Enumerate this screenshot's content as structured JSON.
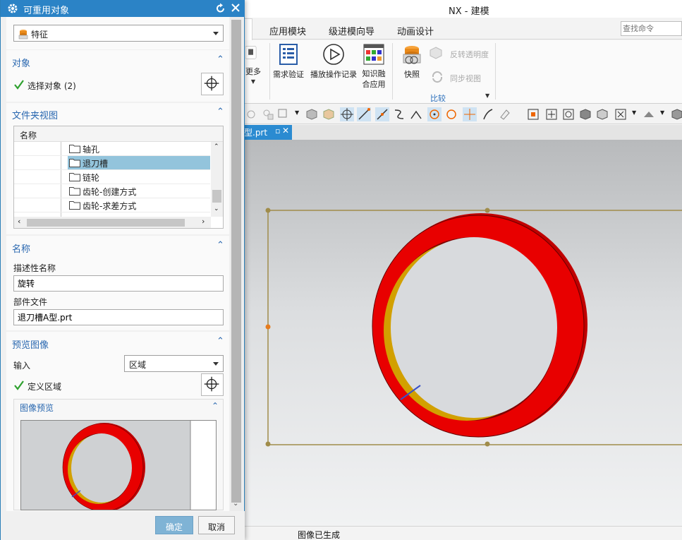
{
  "app": {
    "window_title": "NX - 建模",
    "ribbon_tabs": [
      "应用模块",
      "级进模向导",
      "动画设计"
    ],
    "search_placeholder": "查找命令",
    "ribbon_buttons": {
      "more": "更多",
      "requirements_check": "需求验证",
      "play_recording": "播放操作记录",
      "knowledge_fusion": "知识融合应用",
      "snapshot": "快照",
      "reverse_transparency": "反转透明度",
      "sync_view": "同步视图"
    },
    "ribbon_group_compare": "比较",
    "document_tab": "型.prt",
    "status_text": "图像已生成"
  },
  "dialog": {
    "title": "可重用对象",
    "type_combo": "特征",
    "objects_section": {
      "title": "对象",
      "select_label": "选择对象 (2)"
    },
    "folder_view_section": {
      "title": "文件夹视图",
      "column_header": "名称",
      "items": [
        {
          "label": "轴孔",
          "selected": false
        },
        {
          "label": "退刀槽",
          "selected": true
        },
        {
          "label": "链轮",
          "selected": false
        },
        {
          "label": "齿轮-创建方式",
          "selected": false
        },
        {
          "label": "齿轮-求差方式",
          "selected": false
        }
      ]
    },
    "name_section": {
      "title": "名称",
      "descriptive_name_label": "描述性名称",
      "descriptive_name_value": "旋转",
      "part_file_label": "部件文件",
      "part_file_value": "退刀槽A型.prt"
    },
    "preview_section": {
      "title": "预览图像",
      "input_label": "输入",
      "input_value": "区域",
      "define_region_label": "定义区域",
      "image_preview_title": "图像预览"
    },
    "ok_label": "确定",
    "cancel_label": "取消"
  },
  "colors": {
    "accent": "#2b83c6",
    "ring_red": "#e80000",
    "section_title": "#2a68b0",
    "check_green": "#2fa12f"
  }
}
